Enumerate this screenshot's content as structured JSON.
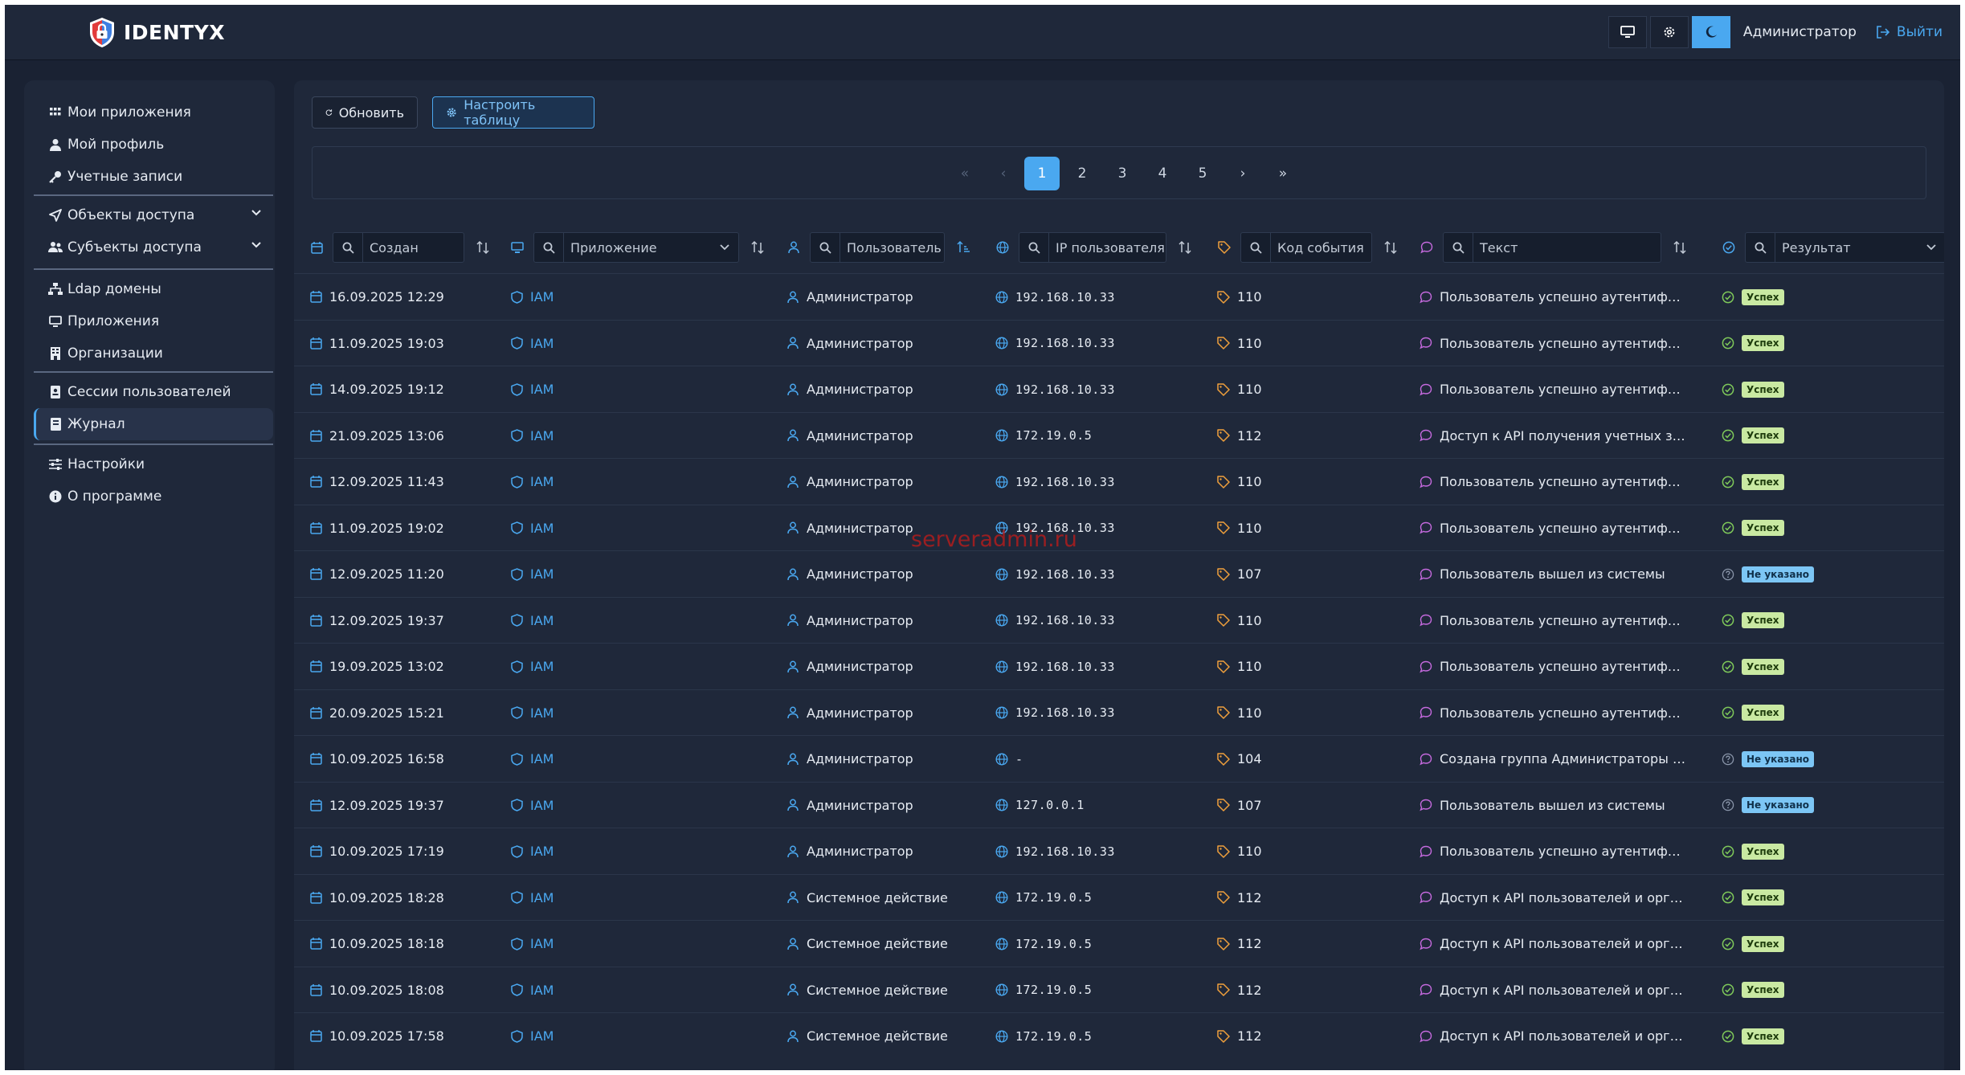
{
  "brand": {
    "name": "IDENTYX"
  },
  "topbar": {
    "user": "Администратор",
    "logout": "Выйти",
    "icons": [
      "monitor-icon",
      "gear-icon",
      "moon-icon"
    ]
  },
  "sidebar": {
    "group1": [
      "Мои приложения",
      "Мой профиль",
      "Учетные записи"
    ],
    "group2": [
      "Объекты доступа",
      "Субъекты доступа"
    ],
    "group3": [
      "Ldap домены",
      "Приложения",
      "Организации"
    ],
    "group4": [
      "Сессии пользователей",
      "Журнал"
    ],
    "group5": [
      "Настройки",
      "О программе"
    ],
    "active": "Журнал"
  },
  "toolbar": {
    "refresh": "Обновить",
    "configure": "Настроить таблицу"
  },
  "pagination": {
    "first": "«",
    "prev": "‹",
    "pages": [
      "1",
      "2",
      "3",
      "4",
      "5"
    ],
    "current": "1",
    "next": "›",
    "last": "»"
  },
  "columns": {
    "created": "Создан",
    "app": "Приложение",
    "user": "Пользователь",
    "ip": "IP пользователя",
    "code": "Код события",
    "text": "Текст",
    "result": "Результат"
  },
  "rows": [
    {
      "created": "16.09.2025 12:29",
      "app": "IAM",
      "user": "Администратор",
      "ip": "192.168.10.33",
      "code": "110",
      "text": "Пользователь успешно аутентифициро...",
      "result": "Успех",
      "status": "ok"
    },
    {
      "created": "11.09.2025 19:03",
      "app": "IAM",
      "user": "Администратор",
      "ip": "192.168.10.33",
      "code": "110",
      "text": "Пользователь успешно аутентифициро...",
      "result": "Успех",
      "status": "ok"
    },
    {
      "created": "14.09.2025 19:12",
      "app": "IAM",
      "user": "Администратор",
      "ip": "192.168.10.33",
      "code": "110",
      "text": "Пользователь успешно аутентифициро...",
      "result": "Успех",
      "status": "ok"
    },
    {
      "created": "21.09.2025 13:06",
      "app": "IAM",
      "user": "Администратор",
      "ip": "172.19.0.5",
      "code": "112",
      "text": "Доступ к API получения учетных записе...",
      "result": "Успех",
      "status": "ok"
    },
    {
      "created": "12.09.2025 11:43",
      "app": "IAM",
      "user": "Администратор",
      "ip": "192.168.10.33",
      "code": "110",
      "text": "Пользователь успешно аутентифициро...",
      "result": "Успех",
      "status": "ok"
    },
    {
      "created": "11.09.2025 19:02",
      "app": "IAM",
      "user": "Администратор",
      "ip": "192.168.10.33",
      "code": "110",
      "text": "Пользователь успешно аутентифициро...",
      "result": "Успех",
      "status": "ok"
    },
    {
      "created": "12.09.2025 11:20",
      "app": "IAM",
      "user": "Администратор",
      "ip": "192.168.10.33",
      "code": "107",
      "text": "Пользователь вышел из системы",
      "result": "Не указано",
      "status": "na"
    },
    {
      "created": "12.09.2025 19:37",
      "app": "IAM",
      "user": "Администратор",
      "ip": "192.168.10.33",
      "code": "110",
      "text": "Пользователь успешно аутентифициро...",
      "result": "Успех",
      "status": "ok"
    },
    {
      "created": "19.09.2025 13:02",
      "app": "IAM",
      "user": "Администратор",
      "ip": "192.168.10.33",
      "code": "110",
      "text": "Пользователь успешно аутентифициро...",
      "result": "Успех",
      "status": "ok"
    },
    {
      "created": "20.09.2025 15:21",
      "app": "IAM",
      "user": "Администратор",
      "ip": "192.168.10.33",
      "code": "110",
      "text": "Пользователь успешно аутентифициро...",
      "result": "Успех",
      "status": "ok"
    },
    {
      "created": "10.09.2025 16:58",
      "app": "IAM",
      "user": "Администратор",
      "ip": "-",
      "code": "104",
      "text": "Создана группа Администраторы прило...",
      "result": "Не указано",
      "status": "na"
    },
    {
      "created": "12.09.2025 19:37",
      "app": "IAM",
      "user": "Администратор",
      "ip": "127.0.0.1",
      "code": "107",
      "text": "Пользователь вышел из системы",
      "result": "Не указано",
      "status": "na"
    },
    {
      "created": "10.09.2025 17:19",
      "app": "IAM",
      "user": "Администратор",
      "ip": "192.168.10.33",
      "code": "110",
      "text": "Пользователь успешно аутентифициро...",
      "result": "Успех",
      "status": "ok"
    },
    {
      "created": "10.09.2025 18:28",
      "app": "IAM",
      "user": "Системное действие",
      "ip": "172.19.0.5",
      "code": "112",
      "text": "Доступ к API пользователей и организа...",
      "result": "Успех",
      "status": "ok"
    },
    {
      "created": "10.09.2025 18:18",
      "app": "IAM",
      "user": "Системное действие",
      "ip": "172.19.0.5",
      "code": "112",
      "text": "Доступ к API пользователей и организа...",
      "result": "Успех",
      "status": "ok"
    },
    {
      "created": "10.09.2025 18:08",
      "app": "IAM",
      "user": "Системное действие",
      "ip": "172.19.0.5",
      "code": "112",
      "text": "Доступ к API пользователей и организа...",
      "result": "Успех",
      "status": "ok"
    },
    {
      "created": "10.09.2025 17:58",
      "app": "IAM",
      "user": "Системное действие",
      "ip": "172.19.0.5",
      "code": "112",
      "text": "Доступ к API пользователей и организа...",
      "result": "Успех",
      "status": "ok"
    }
  ],
  "watermark": "serveradmin.ru",
  "colors": {
    "accent": "#4aa8f0",
    "success": "#c9e9a2",
    "info": "#7cc6f5",
    "background": "#1a2233",
    "panel": "#1f283a"
  }
}
